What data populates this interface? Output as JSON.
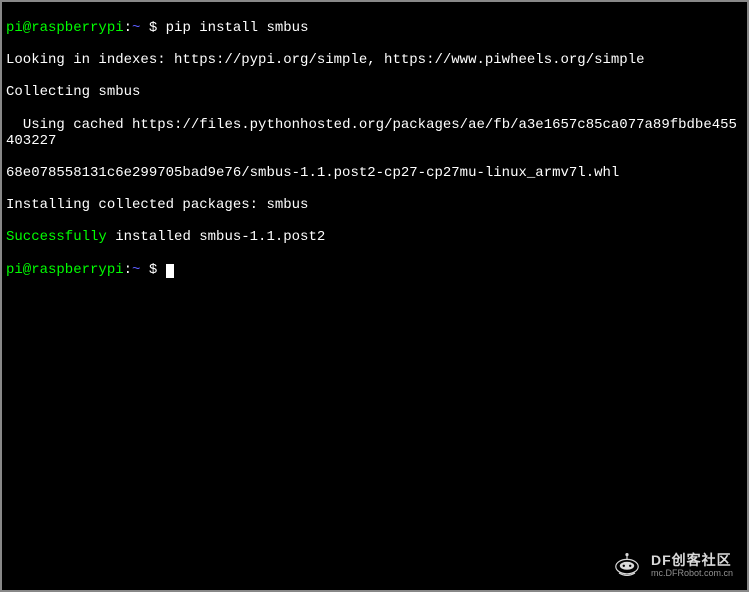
{
  "terminal": {
    "line1": {
      "user": "pi@raspberrypi",
      "path": "~",
      "symbol": " $ ",
      "command": "pip install smbus"
    },
    "output1": "Looking in indexes: https://pypi.org/simple, https://www.piwheels.org/simple",
    "output2": "Collecting smbus",
    "output3": "  Using cached https://files.pythonhosted.org/packages/ae/fb/a3e1657c85ca077a89fbdbe455403227",
    "output4": "68e078558131c6e299705bad9e76/smbus-1.1.post2-cp27-cp27mu-linux_armv7l.whl",
    "output5": "Installing collected packages: smbus",
    "success_word": "Successfully",
    "success_rest": " installed smbus-1.1.post2",
    "line2": {
      "user": "pi@raspberrypi",
      "path": "~",
      "symbol": " $ "
    }
  },
  "watermark": {
    "prefix": "DF",
    "title": "创客社区",
    "url": "mc.DFRobot.com.cn"
  }
}
